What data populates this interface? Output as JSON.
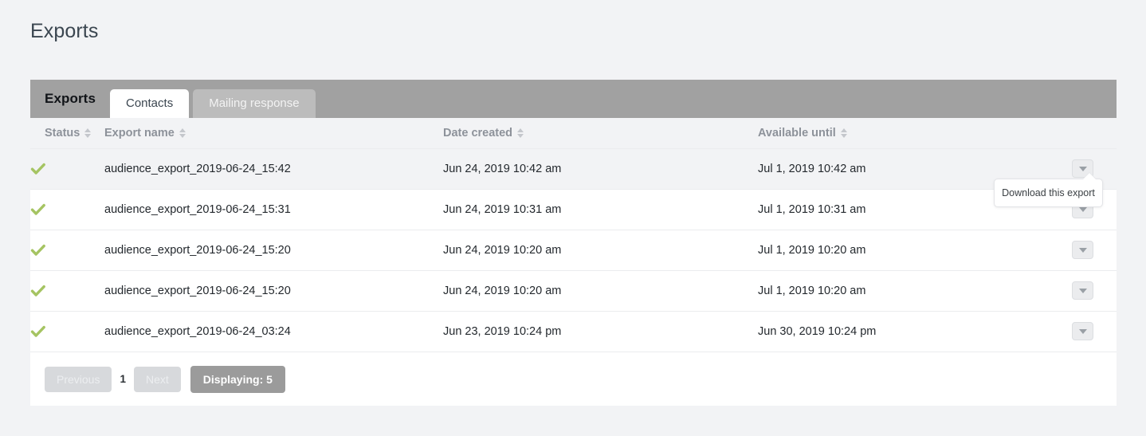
{
  "page": {
    "title": "Exports",
    "background_color": "#f2f3f5"
  },
  "card": {
    "tabbar": {
      "title": "Exports",
      "tabs": [
        {
          "label": "Contacts",
          "state": "active"
        },
        {
          "label": "Mailing response",
          "state": "inactive"
        }
      ],
      "bar_color": "#a1a1a1"
    },
    "table": {
      "columns": [
        {
          "key": "status",
          "label": "Status",
          "sortable": true
        },
        {
          "key": "name",
          "label": "Export name",
          "sortable": true
        },
        {
          "key": "created",
          "label": "Date created",
          "sortable": true
        },
        {
          "key": "available",
          "label": "Available until",
          "sortable": true
        },
        {
          "key": "action",
          "label": "",
          "sortable": false
        }
      ],
      "status_icon": "green-check-icon",
      "status_icon_color": "#a5c462",
      "action_icon": "chevron-down-icon",
      "rows": [
        {
          "status": "complete",
          "name": "audience_export_2019-06-24_15:42",
          "created": "Jun 24, 2019 10:42 am",
          "available": "Jul 1, 2019 10:42 am",
          "highlighted": true
        },
        {
          "status": "complete",
          "name": "audience_export_2019-06-24_15:31",
          "created": "Jun 24, 2019 10:31 am",
          "available": "Jul 1, 2019 10:31 am",
          "highlighted": false
        },
        {
          "status": "complete",
          "name": "audience_export_2019-06-24_15:20",
          "created": "Jun 24, 2019 10:20 am",
          "available": "Jul 1, 2019 10:20 am",
          "highlighted": false
        },
        {
          "status": "complete",
          "name": "audience_export_2019-06-24_15:20",
          "created": "Jun 24, 2019 10:20 am",
          "available": "Jul 1, 2019 10:20 am",
          "highlighted": false
        },
        {
          "status": "complete",
          "name": "audience_export_2019-06-24_03:24",
          "created": "Jun 23, 2019 10:24 pm",
          "available": "Jun 30, 2019 10:24 pm",
          "highlighted": false
        }
      ]
    },
    "pagination": {
      "previous_label": "Previous",
      "previous_disabled": true,
      "current_page": "1",
      "next_label": "Next",
      "next_disabled": true,
      "count_label": "Displaying: 5"
    }
  },
  "tooltip": {
    "text": "Download this export",
    "visible": true
  }
}
